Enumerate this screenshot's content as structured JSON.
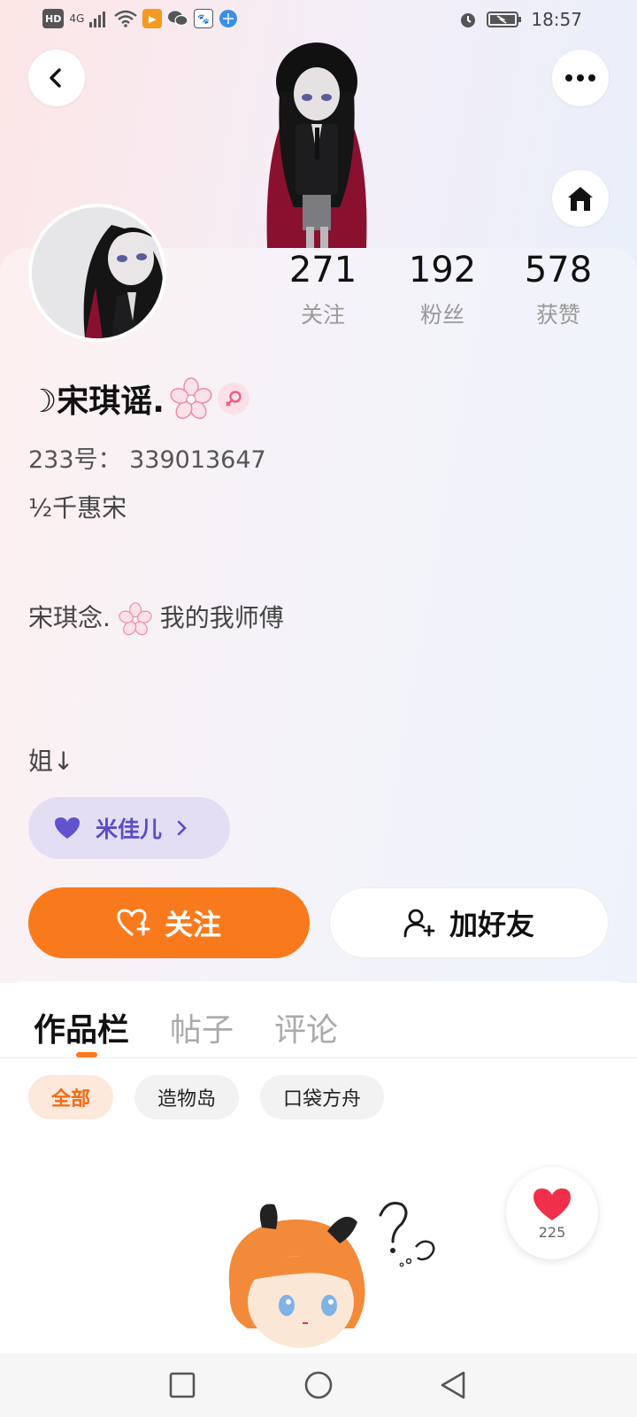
{
  "status_bar": {
    "network": "HD",
    "signal": "4G",
    "time": "18:57"
  },
  "profile": {
    "stats": [
      {
        "value": "271",
        "label": "关注"
      },
      {
        "value": "192",
        "label": "粉丝"
      },
      {
        "value": "578",
        "label": "获赞"
      }
    ],
    "name": "☽宋琪谣.",
    "uid_text": "233号： 339013647",
    "bio_lines": [
      {
        "text": "½千惠宋",
        "has_flower": false
      },
      {
        "text": "宋琪念.",
        "after": "我的我师傅",
        "has_flower": true
      },
      {
        "text": "姐↓",
        "has_flower": false
      }
    ],
    "tag_label": "米佳儿"
  },
  "actions": {
    "follow_label": "关注",
    "add_friend_label": "加好友"
  },
  "tabs": [
    {
      "label": "作品栏",
      "active": true
    },
    {
      "label": "帖子",
      "active": false
    },
    {
      "label": "评论",
      "active": false
    }
  ],
  "filters": [
    {
      "label": "全部",
      "active": true
    },
    {
      "label": "造物岛",
      "active": false
    },
    {
      "label": "口袋方舟",
      "active": false
    }
  ],
  "like_fab": {
    "count": "225"
  },
  "colors": {
    "accent": "#f97a1c",
    "tag_bg": "#e4def4",
    "tag_fg": "#5b4cc4",
    "heart": "#f0304a"
  }
}
